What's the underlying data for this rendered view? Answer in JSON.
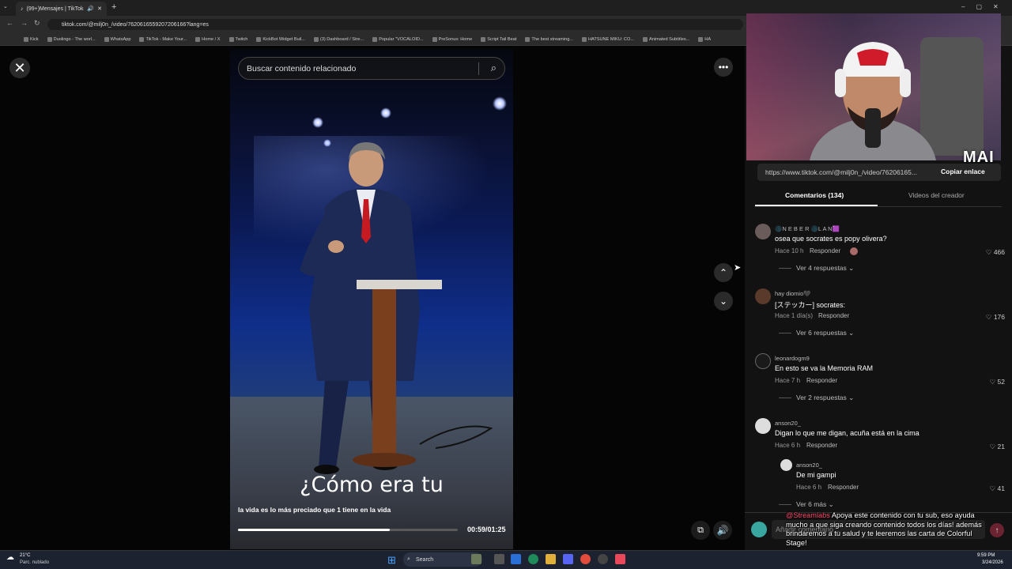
{
  "browser": {
    "tab_title": "(99+)Mensajes | TikTok",
    "url": "tiktok.com/@milj0n_/video/7620616559207206166?lang=es",
    "bookmarks": [
      "Kick",
      "Duolingo - The worl...",
      "WhatsApp",
      "TikTok - Make Your...",
      "Home / X",
      "Twitch",
      "KickBot Widget Buil...",
      "(3) Dashboard / Stre...",
      "Popular \"VOCALOID...",
      "PreSonus: Home",
      "Script Tail Beat",
      "The best streaming...",
      "HATSUNE MIKU: CO...",
      "Animated Subtitles...",
      "HA"
    ]
  },
  "video": {
    "search_placeholder": "Buscar contenido relacionado",
    "subtitle": "¿Cómo era tu",
    "description": "la vida es lo más preciado que 1 tiene en la vida",
    "time": "00:59/01:25",
    "progress_fraction": 0.69
  },
  "overlay": {
    "mai_label": "MAI"
  },
  "panel": {
    "link": "https://www.tiktok.com/@milj0n_/video/76206165...",
    "copy_label": "Copiar enlace",
    "tab_comments": "Comentarios (134)",
    "tab_creator": "Videos del creador",
    "reply_label": "Responder",
    "comments": [
      {
        "user": "🌑N E B E R 🌑L A N🟪",
        "text": "osea que socrates es popy olivera?",
        "time": "Hace 10 h",
        "likes": "466",
        "more": "Ver 4 respuestas"
      },
      {
        "user": "hay diomio🖤",
        "text": "[ステッカー] socrates:",
        "time": "Hace 1 día(s)",
        "likes": "176",
        "more": "Ver 6 respuestas"
      },
      {
        "user": "leonardogm9",
        "text": "En esto se va la Memoria RAM",
        "time": "Hace 7 h",
        "likes": "52",
        "more": "Ver 2 respuestas"
      },
      {
        "user": "anson20_",
        "text": "Digan lo que me digan, acuña está en la cima",
        "time": "Hace 6 h",
        "likes": "21",
        "more": ""
      }
    ],
    "nested_reply": {
      "user": "anson20_",
      "text": "De mi gampi",
      "time": "Hace 6 h",
      "likes": "41"
    },
    "more_nested": "Ver 6 más",
    "add_comment_placeholder": "Añadir comentario..."
  },
  "streamlabs": {
    "handle": "@Streamlabs",
    "message": " Apoya este contenido con tu sub, eso ayuda mucho a que siga creando contenido todos los días! además brindaremos a tu salud y te leeremos las carta de Colorful Stage!"
  },
  "taskbar": {
    "weather_temp": "21°C",
    "weather_desc": "Parc. nublado",
    "search_label": "Search",
    "clock_time": "9:59 PM",
    "clock_date": "3/24/2026"
  }
}
